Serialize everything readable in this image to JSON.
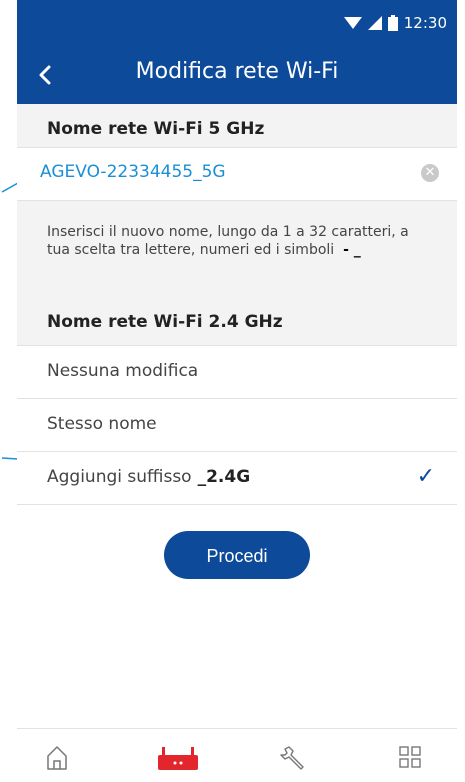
{
  "status": {
    "time": "12:30"
  },
  "header": {
    "title": "Modifica rete Wi-Fi"
  },
  "wifi5": {
    "section_title": "Nome rete Wi-Fi 5 GHz",
    "name": "AGEVO-22334455_5G"
  },
  "hint": {
    "text": "Inserisci il nuovo nome, lungo da 1 a 32 caratteri, a tua scelta tra lettere, numeri ed i simboli",
    "symbols": "- _"
  },
  "wifi24": {
    "section_title": "Nome rete Wi-Fi 2.4 GHz",
    "options": [
      {
        "label": "Nessuna modifica",
        "suffix": ""
      },
      {
        "label": "Stesso nome",
        "suffix": ""
      },
      {
        "label": "Aggiungi suffisso",
        "suffix": "_2.4G"
      }
    ],
    "selected_index": 2
  },
  "actions": {
    "proceed": "Procedi"
  },
  "colors": {
    "brand": "#0d4a99",
    "accent": "#1a8fd6",
    "router": "#e3262c"
  },
  "nav": {
    "items": [
      "home-icon",
      "router-icon",
      "wrench-icon",
      "grid-icon"
    ],
    "active_index": 1
  }
}
